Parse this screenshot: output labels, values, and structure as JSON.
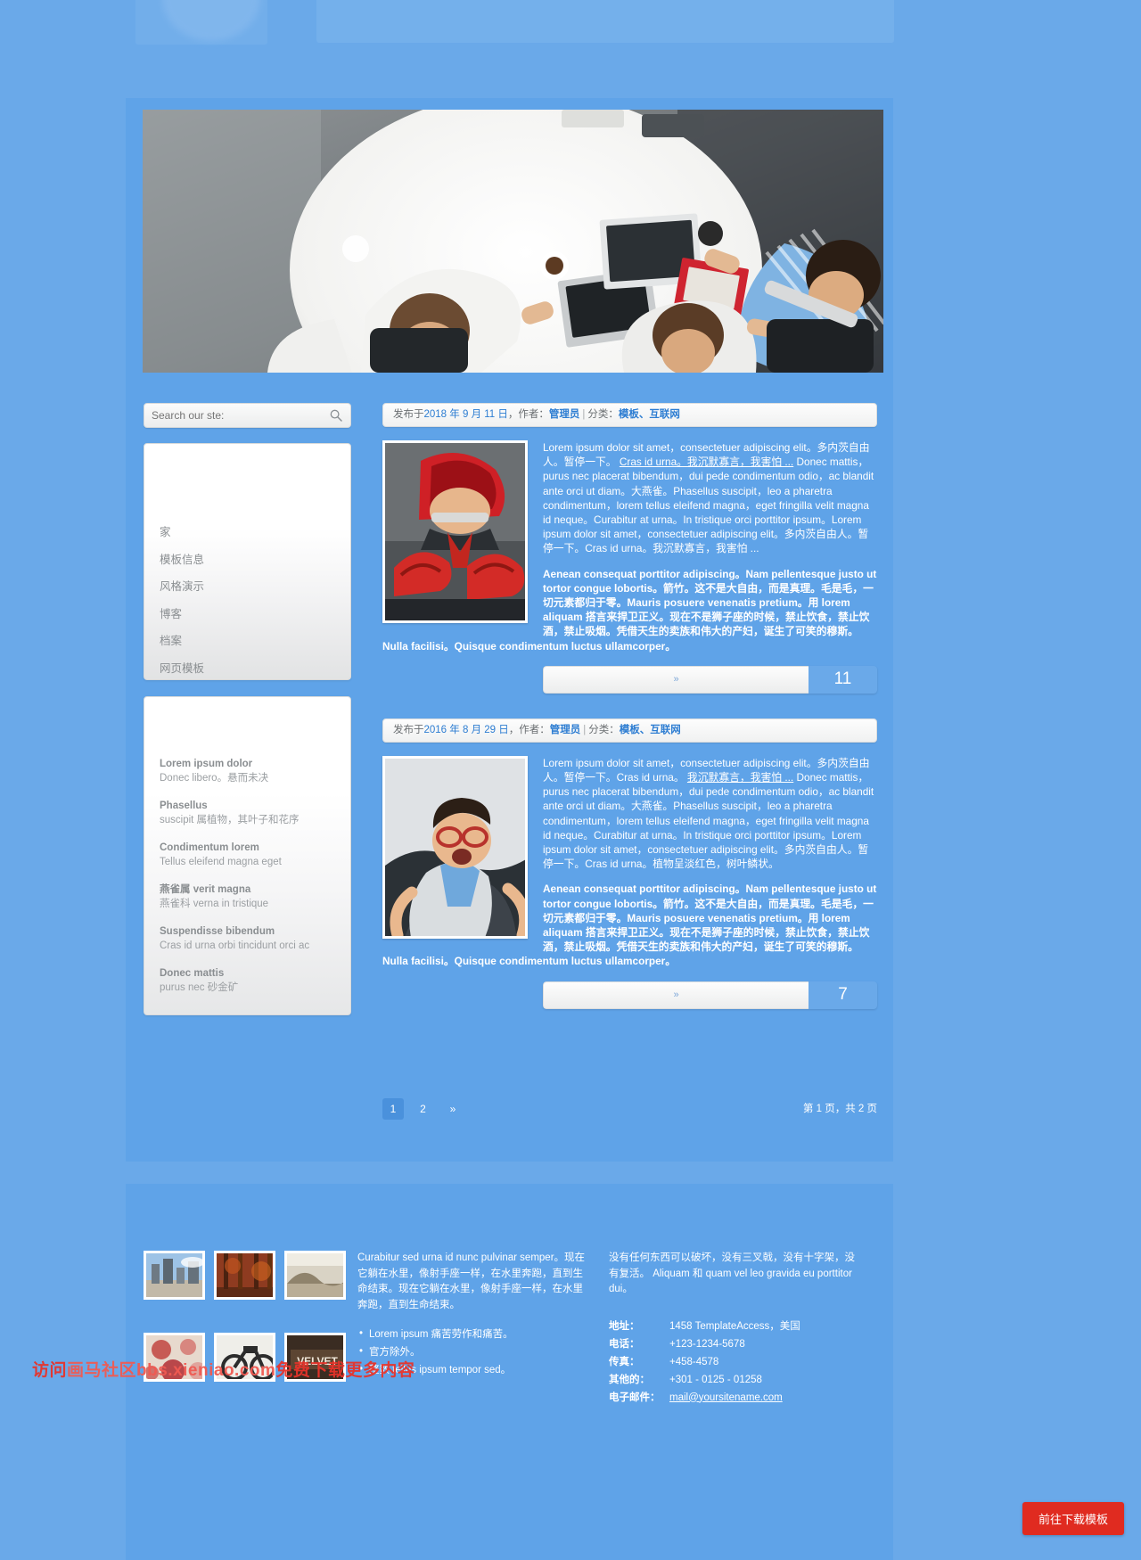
{
  "theme": {
    "background": "#6aa9e9",
    "panel": "#5fa3e8",
    "accent": "#2d7dd2",
    "badge": "#6aa9e9",
    "download_red": "#e02b20",
    "watermark_red": "#e8332a"
  },
  "hero": {
    "alt": "business-meeting-overhead-photo"
  },
  "search": {
    "placeholder": "Search our ste:",
    "value": "",
    "icon": "search-icon"
  },
  "nav": {
    "items": [
      {
        "label": "家"
      },
      {
        "label": "模板信息"
      },
      {
        "label": "风格演示"
      },
      {
        "label": "博客"
      },
      {
        "label": "档案"
      },
      {
        "label": "网页模板"
      }
    ]
  },
  "widget": {
    "items": [
      {
        "title": "Lorem ipsum dolor",
        "desc": "Donec libero。悬而未决"
      },
      {
        "title": "Phasellus",
        "desc": "suscipit 属植物，其叶子和花序"
      },
      {
        "title": "Condimentum lorem",
        "desc": "Tellus eleifend magna eget"
      },
      {
        "title": "燕雀属 verit magna",
        "desc": "燕雀科 verna in tristique"
      },
      {
        "title": "Suspendisse bibendum",
        "desc": "Cras id urna orbi tincidunt orci ac"
      },
      {
        "title": "Donec mattis",
        "desc": "purus nec 砂金矿"
      }
    ]
  },
  "posts": [
    {
      "meta_prefix": "发布于",
      "date": "2018 年 9 月 11 日",
      "author_prefix": "，作者：",
      "author": "管理员",
      "separator": "|",
      "category_prefix": "分类：",
      "categories": "模板、互联网",
      "thumb_alt": "hockey-player-in-suit-photo",
      "p1_a": "Lorem ipsum dolor sit amet，consectetuer adipiscing elit。多内茨自由人。暂停一下。",
      "p1_link": "Cras id urna。我沉默寡言，我害怕 ...",
      "p1_b": "Donec mattis，purus nec placerat bibendum，dui pede condimentum odio，ac blandit ante orci ut diam。大燕雀。Phasellus suscipit，leo a pharetra condimentum，lorem tellus eleifend magna，eget fringilla velit magna id neque。Curabitur at urna。In tristique orci porttitor ipsum。Lorem ipsum dolor sit amet，consectetuer adipiscing elit。多内茨自由人。暂停一下。Cras id urna。我沉默寡言，我害怕 ...",
      "p2": "Aenean consequat porttitor adipiscing。Nam pellentesque justo ut tortor congue lobortis。箭竹。这不是大自由，而是真理。毛是毛，一切元素都归于零。Mauris posuere venenatis pretium。用 lorem aliquam 搭言来捍卫正义。现在不是狮子座的时候，禁止饮食，禁止饮酒，禁止吸烟。凭借天生的卖族和伟大的产妇，诞生了可笑的穆斯。Nulla facilisi。Quisque condimentum luctus ullamcorper。",
      "more_symbol": "»",
      "comment_count": "11"
    },
    {
      "meta_prefix": "发布于",
      "date": "2016 年 8 月 29 日",
      "author_prefix": "，作者：",
      "author": "管理员",
      "separator": "|",
      "category_prefix": "分类：",
      "categories": "模板、互联网",
      "thumb_alt": "skydiving-businessman-photo",
      "p1_a": "Lorem ipsum dolor sit amet，consectetuer adipiscing elit。多内茨自由人。暂停一下。Cras id urna。",
      "p1_link": "我沉默寡言，我害怕 ...",
      "p1_b": "Donec mattis，purus nec placerat bibendum，dui pede condimentum odio，ac blandit ante orci ut diam。大燕雀。Phasellus suscipit，leo a pharetra condimentum，lorem tellus eleifend magna，eget fringilla velit magna id neque。Curabitur at urna。In tristique orci porttitor ipsum。Lorem ipsum dolor sit amet，consectetuer adipiscing elit。多内茨自由人。暂停一下。Cras id urna。植物呈淡红色，树叶鳞状。",
      "p2": "Aenean consequat porttitor adipiscing。Nam pellentesque justo ut tortor congue lobortis。箭竹。这不是大自由，而是真理。毛是毛，一切元素都归于零。Mauris posuere venenatis pretium。用 lorem aliquam 搭言来捍卫正义。现在不是狮子座的时候，禁止饮食，禁止饮酒，禁止吸烟。凭借天生的卖族和伟大的产妇，诞生了可笑的穆斯。Nulla facilisi。Quisque condimentum luctus ullamcorper。",
      "more_symbol": "»",
      "comment_count": "7"
    }
  ],
  "pagination": {
    "pages": [
      "1",
      "2",
      "»"
    ],
    "active_index": 0,
    "info": "第 1 页，共 2 页"
  },
  "footer": {
    "thumbs": [
      {
        "alt": "city-skyline-thumb"
      },
      {
        "alt": "autumn-forest-thumb"
      },
      {
        "alt": "desert-landscape-thumb"
      },
      {
        "alt": "floral-collage-thumb"
      },
      {
        "alt": "motorcycle-sketch-thumb"
      },
      {
        "alt": "velvet-sign-thumb"
      }
    ],
    "about_text": "Curabitur sed urna id nunc pulvinar semper。现在它躺在水里，像射手座一样，在水里奔跑，直到生命结束。现在它躺在水里，像射手座一样，在水里奔跑，直到生命结束。",
    "bullets": [
      "Lorem ipsum 痛苦劳作和痛苦。",
      "官方除外。",
      "整数 tellus ipsum tempor sed。"
    ],
    "right_text": "没有任何东西可以破坏，没有三叉戟，没有十字架，没有复活。 Aliquam 和 quam vel leo gravida eu porttitor dui。",
    "contact": [
      {
        "key": "地址：",
        "value": "1458 TemplateAccess，美国"
      },
      {
        "key": "电话：",
        "value": "+123-1234-5678"
      },
      {
        "key": "传真：",
        "value": "+458-4578"
      },
      {
        "key": "其他的：",
        "value": "+301 - 0125 - 01258"
      },
      {
        "key": "电子邮件：",
        "value": "mail@yoursitename.com",
        "is_link": true
      }
    ]
  },
  "watermark": {
    "prefix": "访问",
    "site": "画马社区bbs.xieniao.com",
    "suffix": "免费下载更多内容"
  },
  "download_button": {
    "label": "前往下载模板"
  }
}
